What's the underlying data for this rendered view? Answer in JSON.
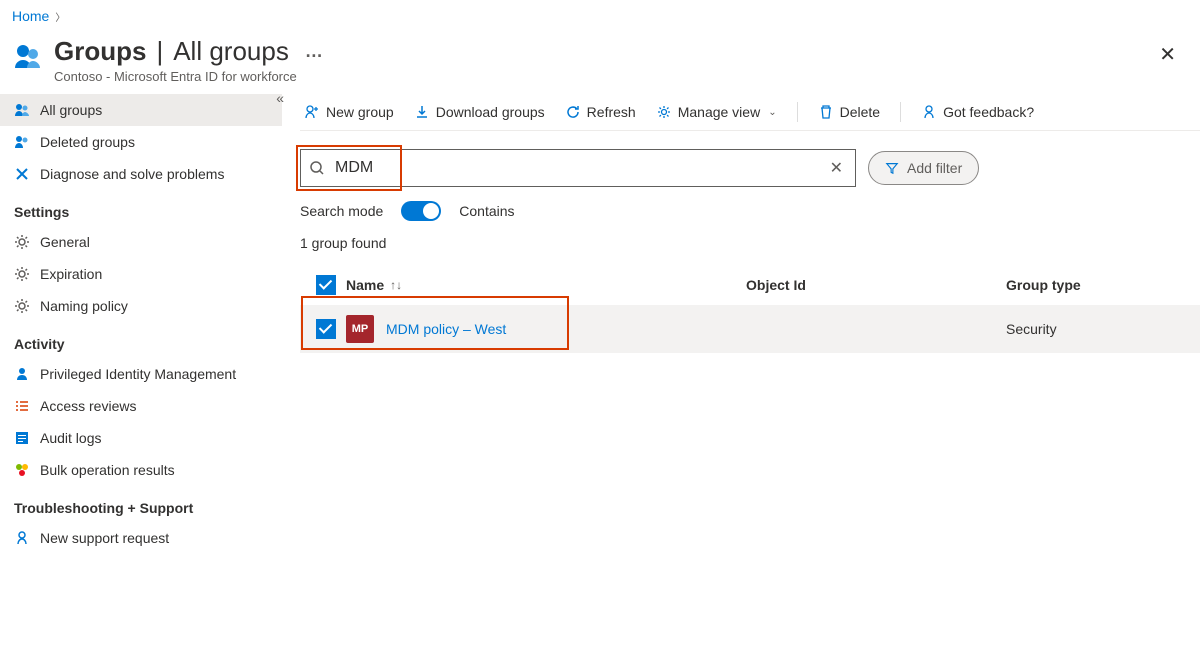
{
  "breadcrumb": {
    "home": "Home"
  },
  "header": {
    "title_main": "Groups",
    "title_sep": "|",
    "title_sub": "All groups",
    "more": "…",
    "subtitle": "Contoso - Microsoft Entra ID for workforce"
  },
  "sidebar": {
    "items": [
      {
        "label": "All groups"
      },
      {
        "label": "Deleted groups"
      },
      {
        "label": "Diagnose and solve problems"
      }
    ],
    "settings_heading": "Settings",
    "settings": [
      {
        "label": "General"
      },
      {
        "label": "Expiration"
      },
      {
        "label": "Naming policy"
      }
    ],
    "activity_heading": "Activity",
    "activity": [
      {
        "label": "Privileged Identity Management"
      },
      {
        "label": "Access reviews"
      },
      {
        "label": "Audit logs"
      },
      {
        "label": "Bulk operation results"
      }
    ],
    "support_heading": "Troubleshooting + Support",
    "support": [
      {
        "label": "New support request"
      }
    ]
  },
  "cmdbar": {
    "new_group": "New group",
    "download": "Download groups",
    "refresh": "Refresh",
    "manage_view": "Manage view",
    "delete": "Delete",
    "feedback": "Got feedback?"
  },
  "search": {
    "value": "MDM",
    "add_filter": "Add filter",
    "mode_label": "Search mode",
    "mode_value": "Contains",
    "count_text": "1 group found"
  },
  "table": {
    "columns": {
      "name": "Name",
      "object_id": "Object Id",
      "group_type": "Group type"
    },
    "rows": [
      {
        "avatar": "MP",
        "name": "MDM policy – West",
        "object_id": "",
        "group_type": "Security"
      }
    ]
  }
}
